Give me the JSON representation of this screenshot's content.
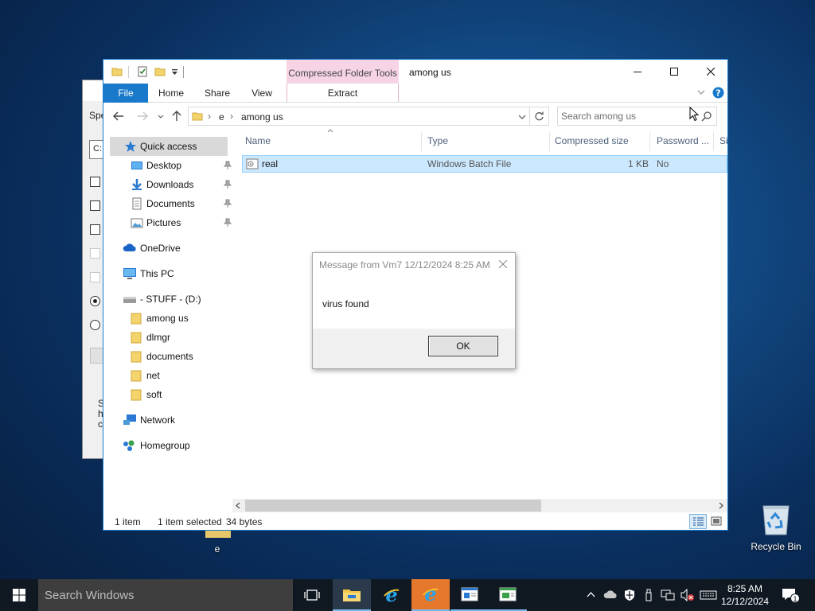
{
  "bg_dialog": {
    "label_partial": "Spe",
    "input_partial": "C:",
    "text_partial": "S h c"
  },
  "explorer": {
    "title": "among us",
    "contextual_tab_group": "Compressed Folder Tools",
    "tabs": [
      "File",
      "Home",
      "Share",
      "View",
      "Extract"
    ],
    "address": {
      "segments": [
        "e",
        "among us"
      ]
    },
    "search_placeholder": "Search among us",
    "nav": {
      "quick_access": "Quick access",
      "desktop": "Desktop",
      "downloads": "Downloads",
      "documents": "Documents",
      "pictures": "Pictures",
      "onedrive": "OneDrive",
      "this_pc": "This PC",
      "drive": "- STUFF - (D:)",
      "among_us": "among us",
      "dlmgr": "dlmgr",
      "documents_folder": "documents",
      "net": "net",
      "soft": "soft",
      "network": "Network",
      "homegroup": "Homegroup"
    },
    "columns": [
      "Name",
      "Type",
      "Compressed size",
      "Password ...",
      "Si"
    ],
    "files": [
      {
        "name": "real",
        "type": "Windows Batch File",
        "compressed_size": "1 KB",
        "password": "No"
      }
    ],
    "status": {
      "count": "1 item",
      "selected": "1 item selected",
      "size": "34 bytes"
    }
  },
  "message_box": {
    "title": "Message from Vm7 12/12/2024 8:25 AM",
    "text": "virus found",
    "ok_label": "OK"
  },
  "desktop": {
    "recycle_bin": "Recycle Bin",
    "e_label": "e"
  },
  "taskbar": {
    "search_placeholder": "Search Windows",
    "time": "8:25 AM",
    "date": "12/12/2024",
    "notification_count": "1"
  },
  "colors": {
    "accent": "#1979ca",
    "selection": "#cce8ff",
    "contextual_tab": "#f6d4e6",
    "taskbar": "#101922",
    "highlight_app": "#e6782d"
  }
}
